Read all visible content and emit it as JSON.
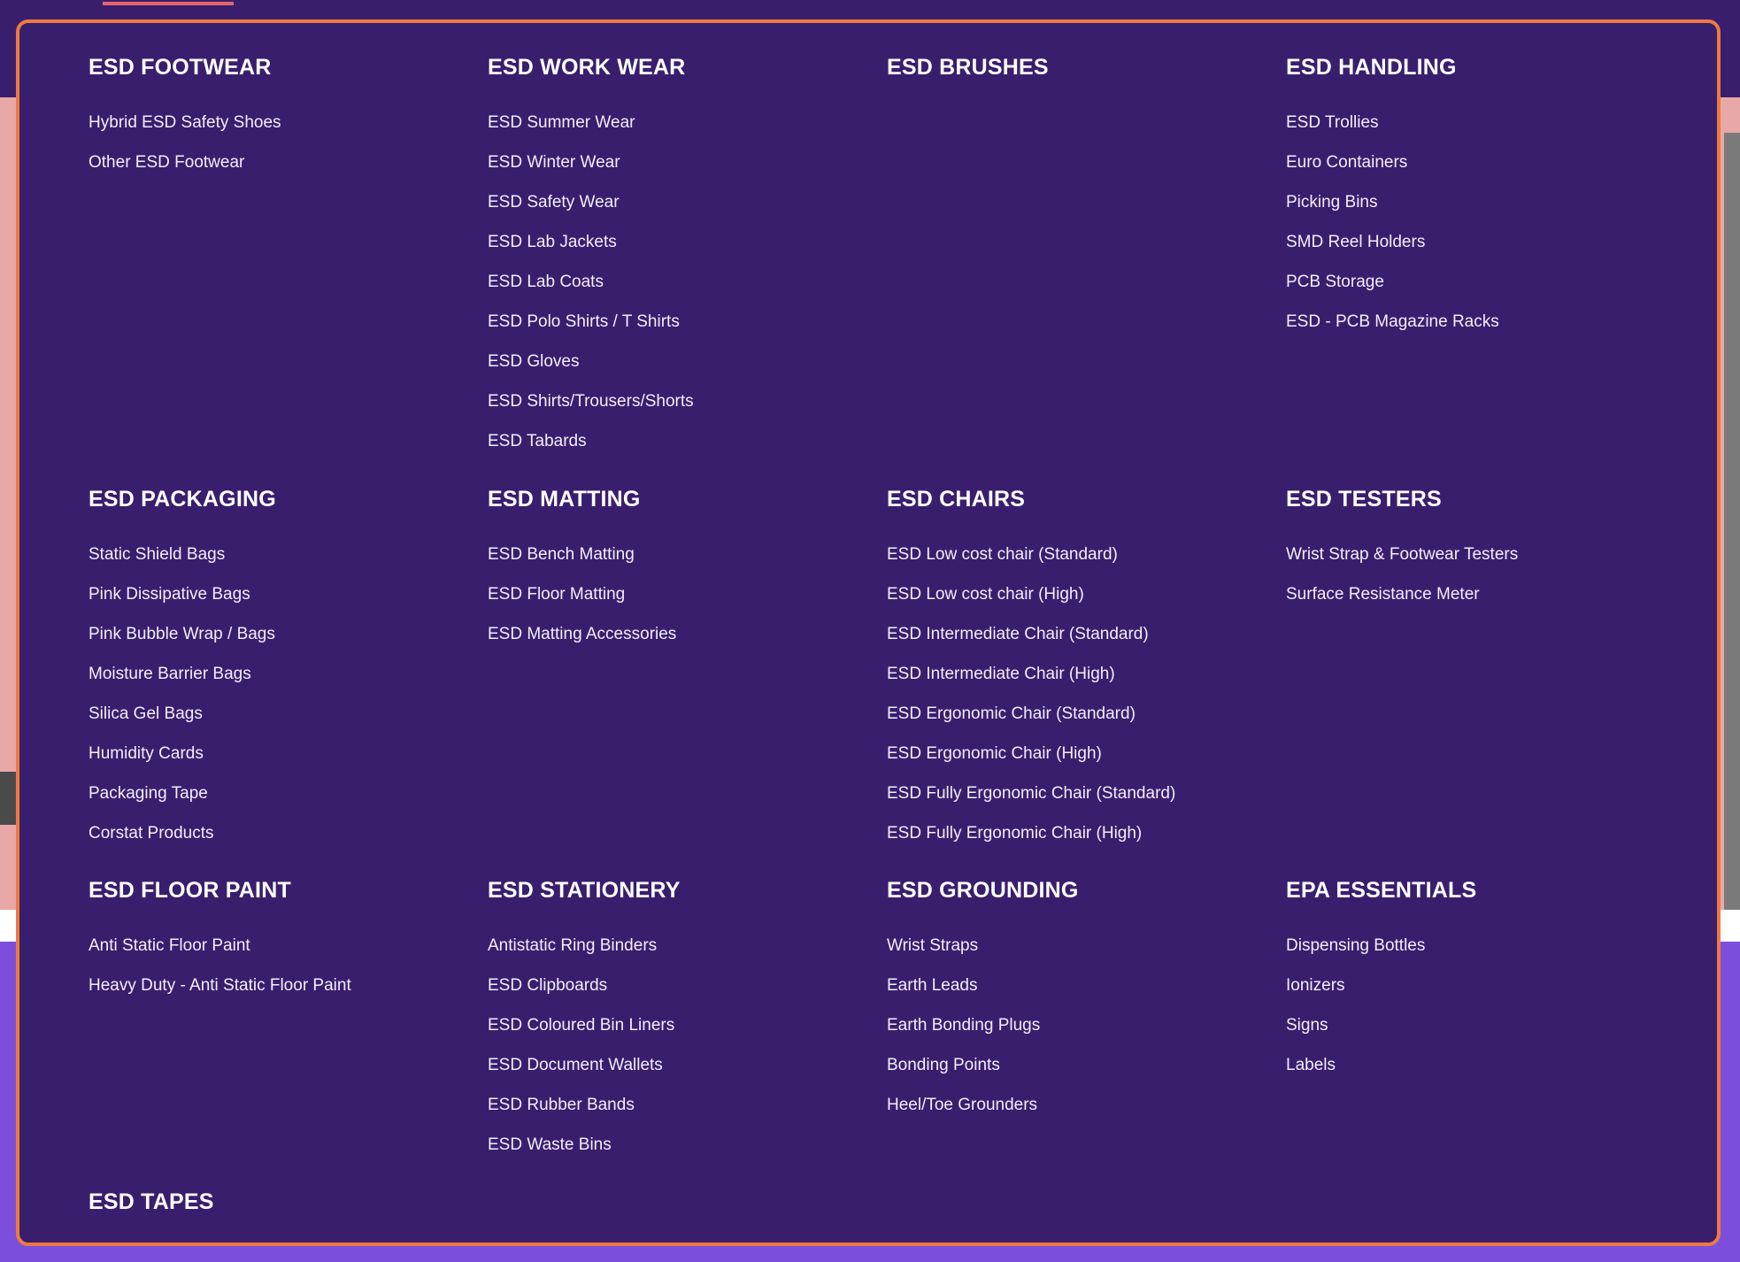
{
  "colors": {
    "panel_bg": "#3a1e6e",
    "panel_border": "#ee7a3f",
    "heading": "#ffffff",
    "link": "#f2eefa",
    "hero_bg": "#e8a8a8",
    "lower_bg": "#7b4fdc"
  },
  "menu": {
    "rows": [
      [
        {
          "heading": "ESD FOOTWEAR",
          "links": [
            "Hybrid ESD Safety Shoes",
            "Other ESD Footwear"
          ]
        },
        {
          "heading": "ESD WORK WEAR",
          "links": [
            "ESD Summer Wear",
            "ESD Winter Wear",
            "ESD Safety Wear",
            "ESD Lab Jackets",
            "ESD Lab Coats",
            "ESD Polo Shirts / T Shirts",
            "ESD Gloves",
            "ESD Shirts/Trousers/Shorts",
            "ESD Tabards"
          ]
        },
        {
          "heading": "ESD BRUSHES",
          "links": []
        },
        {
          "heading": "ESD HANDLING",
          "links": [
            "ESD Trollies",
            "Euro Containers",
            "Picking Bins",
            "SMD Reel Holders",
            "PCB Storage",
            "ESD - PCB Magazine Racks"
          ]
        }
      ],
      [
        {
          "heading": "ESD PACKAGING",
          "links": [
            "Static Shield Bags",
            "Pink Dissipative Bags",
            "Pink Bubble Wrap / Bags",
            "Moisture Barrier Bags",
            "Silica Gel Bags",
            "Humidity Cards",
            "Packaging Tape",
            "Corstat Products"
          ]
        },
        {
          "heading": "ESD MATTING",
          "links": [
            "ESD Bench Matting",
            "ESD Floor Matting",
            "ESD Matting Accessories"
          ]
        },
        {
          "heading": "ESD CHAIRS",
          "links": [
            "ESD Low cost chair (Standard)",
            "ESD Low cost chair (High)",
            "ESD Intermediate Chair (Standard)",
            "ESD Intermediate Chair (High)",
            "ESD Ergonomic Chair (Standard)",
            "ESD Ergonomic Chair (High)",
            "ESD Fully Ergonomic Chair (Standard)",
            "ESD Fully Ergonomic Chair (High)"
          ]
        },
        {
          "heading": "ESD TESTERS",
          "links": [
            "Wrist Strap & Footwear Testers",
            "Surface Resistance Meter"
          ]
        }
      ],
      [
        {
          "heading": "ESD FLOOR PAINT",
          "links": [
            "Anti Static Floor Paint",
            "Heavy Duty - Anti Static Floor Paint"
          ]
        },
        {
          "heading": "ESD STATIONERY",
          "links": [
            "Antistatic Ring Binders",
            "ESD Clipboards",
            "ESD Coloured Bin Liners",
            "ESD Document Wallets",
            "ESD Rubber Bands",
            "ESD Waste Bins"
          ]
        },
        {
          "heading": "ESD GROUNDING",
          "links": [
            "Wrist Straps",
            "Earth Leads",
            "Earth Bonding Plugs",
            "Bonding Points",
            "Heel/Toe Grounders"
          ]
        },
        {
          "heading": "EPA ESSENTIALS",
          "links": [
            "Dispensing Bottles",
            "Ionizers",
            "Signs",
            "Labels"
          ]
        }
      ],
      [
        {
          "heading": "ESD TAPES",
          "links": []
        }
      ]
    ]
  }
}
